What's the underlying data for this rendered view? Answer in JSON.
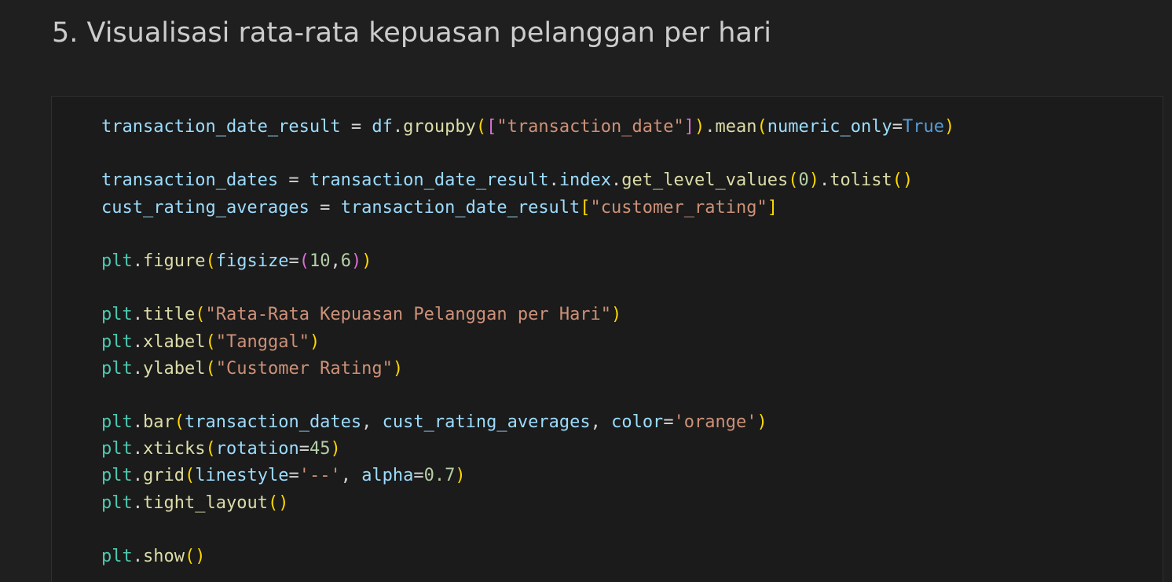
{
  "heading": "5. Visualisasi rata-rata kepuasan pelanggan per hari",
  "theme": {
    "background": "#1f1f1f",
    "cell_background": "#1b1b1b",
    "cell_border": "#2f2f2f",
    "heading_color": "#cccccc",
    "token_colors": {
      "var": "#9cdcfe",
      "mod": "#4ec9b0",
      "fn": "#dcdcaa",
      "str": "#ce9178",
      "num": "#b5cea8",
      "kw": "#569cd6",
      "p1": "#ffd700",
      "p2": "#da70d6",
      "p3": "#179fff",
      "op": "#d4d4d4"
    }
  },
  "code_cell": {
    "lines": [
      [
        [
          "var",
          "transaction_date_result"
        ],
        [
          "op",
          " = "
        ],
        [
          "var",
          "df"
        ],
        [
          "op",
          "."
        ],
        [
          "fn",
          "groupby"
        ],
        [
          "p1",
          "("
        ],
        [
          "p2",
          "["
        ],
        [
          "str",
          "\"transaction_date\""
        ],
        [
          "p2",
          "]"
        ],
        [
          "p1",
          ")"
        ],
        [
          "op",
          "."
        ],
        [
          "fn",
          "mean"
        ],
        [
          "p1",
          "("
        ],
        [
          "var",
          "numeric_only"
        ],
        [
          "op",
          "="
        ],
        [
          "kw",
          "True"
        ],
        [
          "p1",
          ")"
        ]
      ],
      [],
      [
        [
          "var",
          "transaction_dates"
        ],
        [
          "op",
          " = "
        ],
        [
          "var",
          "transaction_date_result"
        ],
        [
          "op",
          "."
        ],
        [
          "var",
          "index"
        ],
        [
          "op",
          "."
        ],
        [
          "fn",
          "get_level_values"
        ],
        [
          "p1",
          "("
        ],
        [
          "num",
          "0"
        ],
        [
          "p1",
          ")"
        ],
        [
          "op",
          "."
        ],
        [
          "fn",
          "tolist"
        ],
        [
          "p1",
          "()"
        ]
      ],
      [
        [
          "var",
          "cust_rating_averages"
        ],
        [
          "op",
          " = "
        ],
        [
          "var",
          "transaction_date_result"
        ],
        [
          "p1",
          "["
        ],
        [
          "str",
          "\"customer_rating\""
        ],
        [
          "p1",
          "]"
        ]
      ],
      [],
      [
        [
          "mod",
          "plt"
        ],
        [
          "op",
          "."
        ],
        [
          "fn",
          "figure"
        ],
        [
          "p1",
          "("
        ],
        [
          "var",
          "figsize"
        ],
        [
          "op",
          "="
        ],
        [
          "p2",
          "("
        ],
        [
          "num",
          "10"
        ],
        [
          "op",
          ","
        ],
        [
          "num",
          "6"
        ],
        [
          "p2",
          ")"
        ],
        [
          "p1",
          ")"
        ]
      ],
      [],
      [
        [
          "mod",
          "plt"
        ],
        [
          "op",
          "."
        ],
        [
          "fn",
          "title"
        ],
        [
          "p1",
          "("
        ],
        [
          "str",
          "\"Rata-Rata Kepuasan Pelanggan per Hari\""
        ],
        [
          "p1",
          ")"
        ]
      ],
      [
        [
          "mod",
          "plt"
        ],
        [
          "op",
          "."
        ],
        [
          "fn",
          "xlabel"
        ],
        [
          "p1",
          "("
        ],
        [
          "str",
          "\"Tanggal\""
        ],
        [
          "p1",
          ")"
        ]
      ],
      [
        [
          "mod",
          "plt"
        ],
        [
          "op",
          "."
        ],
        [
          "fn",
          "ylabel"
        ],
        [
          "p1",
          "("
        ],
        [
          "str",
          "\"Customer Rating\""
        ],
        [
          "p1",
          ")"
        ]
      ],
      [],
      [
        [
          "mod",
          "plt"
        ],
        [
          "op",
          "."
        ],
        [
          "fn",
          "bar"
        ],
        [
          "p1",
          "("
        ],
        [
          "var",
          "transaction_dates"
        ],
        [
          "op",
          ", "
        ],
        [
          "var",
          "cust_rating_averages"
        ],
        [
          "op",
          ", "
        ],
        [
          "var",
          "color"
        ],
        [
          "op",
          "="
        ],
        [
          "str",
          "'orange'"
        ],
        [
          "p1",
          ")"
        ]
      ],
      [
        [
          "mod",
          "plt"
        ],
        [
          "op",
          "."
        ],
        [
          "fn",
          "xticks"
        ],
        [
          "p1",
          "("
        ],
        [
          "var",
          "rotation"
        ],
        [
          "op",
          "="
        ],
        [
          "num",
          "45"
        ],
        [
          "p1",
          ")"
        ]
      ],
      [
        [
          "mod",
          "plt"
        ],
        [
          "op",
          "."
        ],
        [
          "fn",
          "grid"
        ],
        [
          "p1",
          "("
        ],
        [
          "var",
          "linestyle"
        ],
        [
          "op",
          "="
        ],
        [
          "str",
          "'--'"
        ],
        [
          "op",
          ", "
        ],
        [
          "var",
          "alpha"
        ],
        [
          "op",
          "="
        ],
        [
          "num",
          "0.7"
        ],
        [
          "p1",
          ")"
        ]
      ],
      [
        [
          "mod",
          "plt"
        ],
        [
          "op",
          "."
        ],
        [
          "fn",
          "tight_layout"
        ],
        [
          "p1",
          "()"
        ]
      ],
      [],
      [
        [
          "mod",
          "plt"
        ],
        [
          "op",
          "."
        ],
        [
          "fn",
          "show"
        ],
        [
          "p1",
          "()"
        ]
      ]
    ]
  }
}
